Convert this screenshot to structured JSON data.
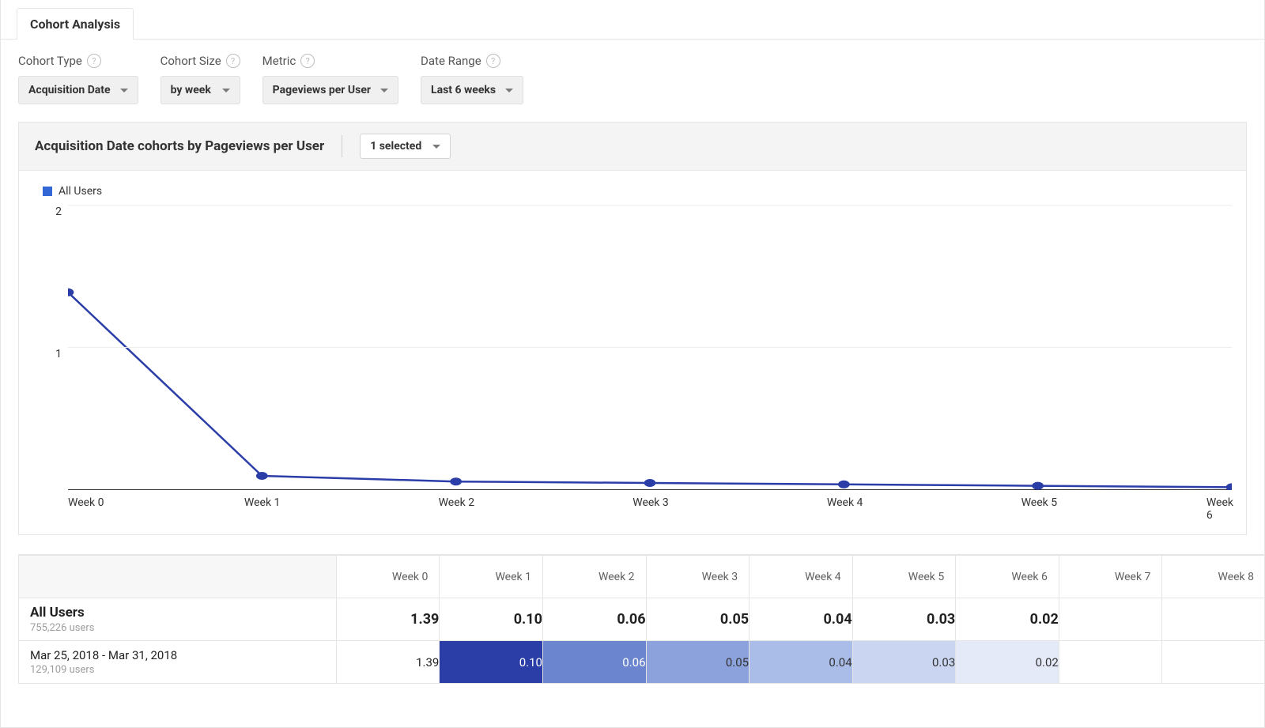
{
  "tab": {
    "label": "Cohort Analysis"
  },
  "controls": {
    "cohort_type": {
      "label": "Cohort Type",
      "value": "Acquisition Date"
    },
    "cohort_size": {
      "label": "Cohort Size",
      "value": "by week"
    },
    "metric": {
      "label": "Metric",
      "value": "Pageviews per User"
    },
    "date_range": {
      "label": "Date Range",
      "value": "Last 6 weeks"
    }
  },
  "chart": {
    "title": "Acquisition Date cohorts by Pageviews per User",
    "selector_value": "1 selected",
    "legend_label": "All Users",
    "y_ticks": [
      "2",
      "1",
      ""
    ],
    "x_labels": [
      "Week 0",
      "Week 1",
      "Week 2",
      "Week 3",
      "Week 4",
      "Week 5",
      "Week 6"
    ],
    "series_color": "#2b3ea8"
  },
  "chart_data": {
    "type": "line",
    "title": "Acquisition Date cohorts by Pageviews per User",
    "xlabel": "",
    "ylabel": "",
    "ylim": [
      0,
      2
    ],
    "categories": [
      "Week 0",
      "Week 1",
      "Week 2",
      "Week 3",
      "Week 4",
      "Week 5",
      "Week 6"
    ],
    "series": [
      {
        "name": "All Users",
        "values": [
          1.39,
          0.1,
          0.06,
          0.05,
          0.04,
          0.03,
          0.02
        ]
      }
    ]
  },
  "table": {
    "columns": [
      "Week 0",
      "Week 1",
      "Week 2",
      "Week 3",
      "Week 4",
      "Week 5",
      "Week 6",
      "Week 7",
      "Week 8"
    ],
    "rows": [
      {
        "label": "All Users",
        "sublabel": "755,226 users",
        "bold": true,
        "cells": [
          {
            "text": "1.39"
          },
          {
            "text": "0.10"
          },
          {
            "text": "0.06"
          },
          {
            "text": "0.05"
          },
          {
            "text": "0.04"
          },
          {
            "text": "0.03"
          },
          {
            "text": "0.02"
          },
          {
            "text": ""
          },
          {
            "text": ""
          }
        ]
      },
      {
        "label": "Mar 25, 2018 - Mar 31, 2018",
        "sublabel": "129,109 users",
        "bold": false,
        "cells": [
          {
            "text": "1.39"
          },
          {
            "text": "0.10",
            "bg": "#2b3ea8",
            "fg": "#ffffff"
          },
          {
            "text": "0.06",
            "bg": "#6b86cf",
            "fg": "#ffffff"
          },
          {
            "text": "0.05",
            "bg": "#8ba2dc",
            "fg": "#333333"
          },
          {
            "text": "0.04",
            "bg": "#aabce8",
            "fg": "#333333"
          },
          {
            "text": "0.03",
            "bg": "#c9d5f1",
            "fg": "#333333"
          },
          {
            "text": "0.02",
            "bg": "#e4eaf8",
            "fg": "#333333"
          },
          {
            "text": ""
          },
          {
            "text": ""
          }
        ]
      }
    ]
  }
}
